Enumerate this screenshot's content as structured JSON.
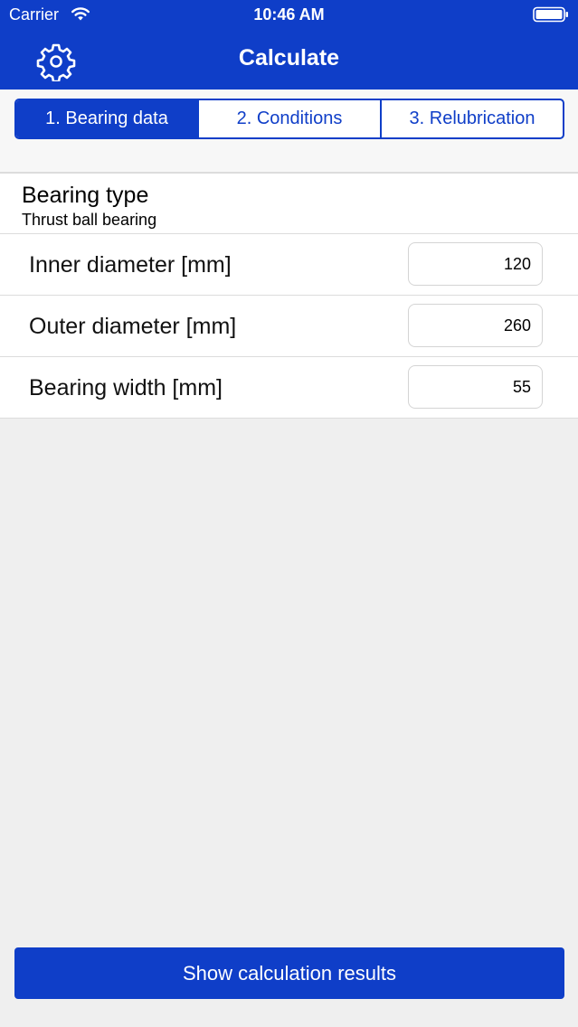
{
  "status_bar": {
    "carrier": "Carrier",
    "time": "10:46 AM"
  },
  "nav": {
    "title": "Calculate",
    "settings_icon": "gear-icon"
  },
  "tabs": [
    {
      "label": "1. Bearing data",
      "active": true
    },
    {
      "label": "2. Conditions",
      "active": false
    },
    {
      "label": "3. Relubrication",
      "active": false
    }
  ],
  "bearing_type": {
    "title": "Bearing type",
    "value": "Thrust ball bearing"
  },
  "fields": [
    {
      "label": "Inner diameter [mm]",
      "value": "120"
    },
    {
      "label": "Outer diameter [mm]",
      "value": "260"
    },
    {
      "label": "Bearing width [mm]",
      "value": "55"
    }
  ],
  "actions": {
    "show_results": "Show calculation results"
  },
  "colors": {
    "brand_blue": "#0f3ec8",
    "background": "#efefef"
  }
}
